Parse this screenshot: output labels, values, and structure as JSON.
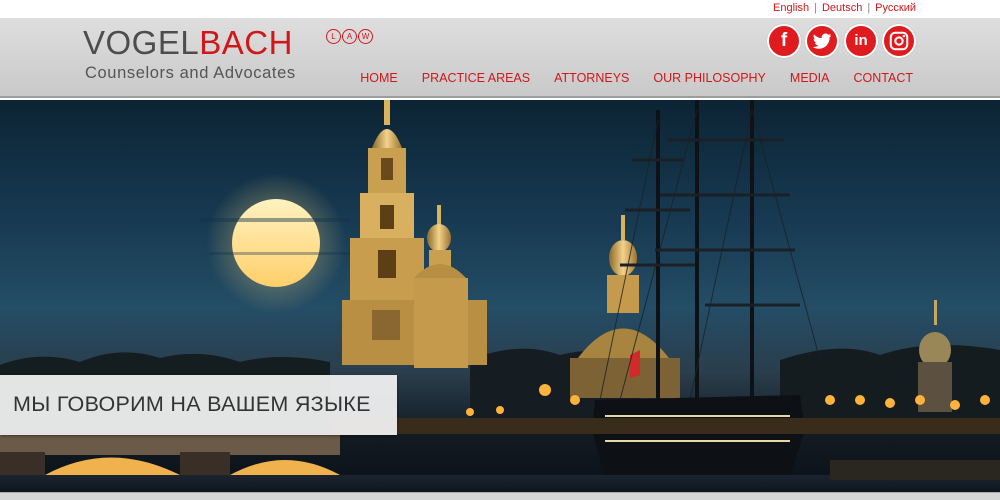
{
  "languages": [
    "English",
    "Deutsch",
    "Русский"
  ],
  "logo": {
    "part1": "VOGEL",
    "part2": "BACH",
    "badge": [
      "L",
      "A",
      "W"
    ],
    "tagline": "Counselors and Advocates"
  },
  "social": [
    {
      "name": "facebook-icon",
      "glyph": "f"
    },
    {
      "name": "twitter-icon",
      "glyph": "t"
    },
    {
      "name": "linkedin-icon",
      "glyph": "in"
    },
    {
      "name": "instagram-icon",
      "glyph": "◎"
    }
  ],
  "nav": [
    "HOME",
    "PRACTICE AREAS",
    "ATTORNEYS",
    "OUR PHILOSOPHY",
    "MEDIA",
    "CONTACT"
  ],
  "hero": {
    "headline": "МЫ ГОВОРИМ НА ВАШЕМ ЯЗЫКЕ"
  },
  "colors": {
    "accent": "#d0181b",
    "header_bg": "#d4d4d4",
    "text_gray": "#4d4d4d"
  }
}
